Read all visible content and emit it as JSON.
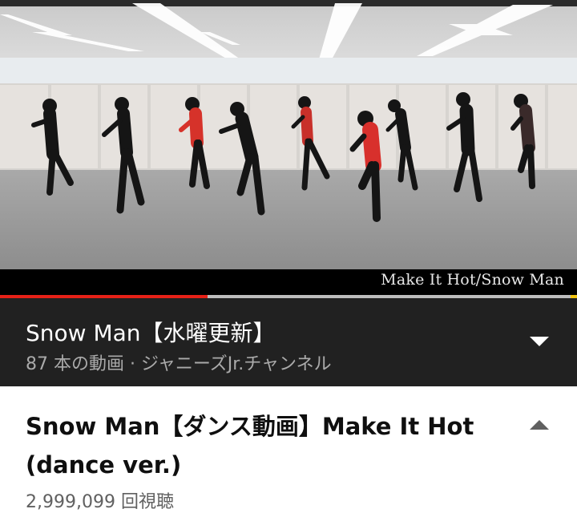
{
  "player": {
    "caption": "Make It Hot/Snow Man",
    "progress": 0.36,
    "buffered": 1.0,
    "progress_color": "#e62117"
  },
  "playlist": {
    "title": "Snow Man【水曜更新】",
    "meta": "87 本の動画 · ジャニーズJr.チャンネル",
    "toggle_icon": "chevron-down-icon"
  },
  "video": {
    "title": "Snow Man【ダンス動画】Make It Hot (dance ver.)",
    "views": "2,999,099 回視聴",
    "toggle_icon": "chevron-up-icon"
  },
  "colors": {
    "playlist_bg": "#212121",
    "accent": "#e62117"
  }
}
